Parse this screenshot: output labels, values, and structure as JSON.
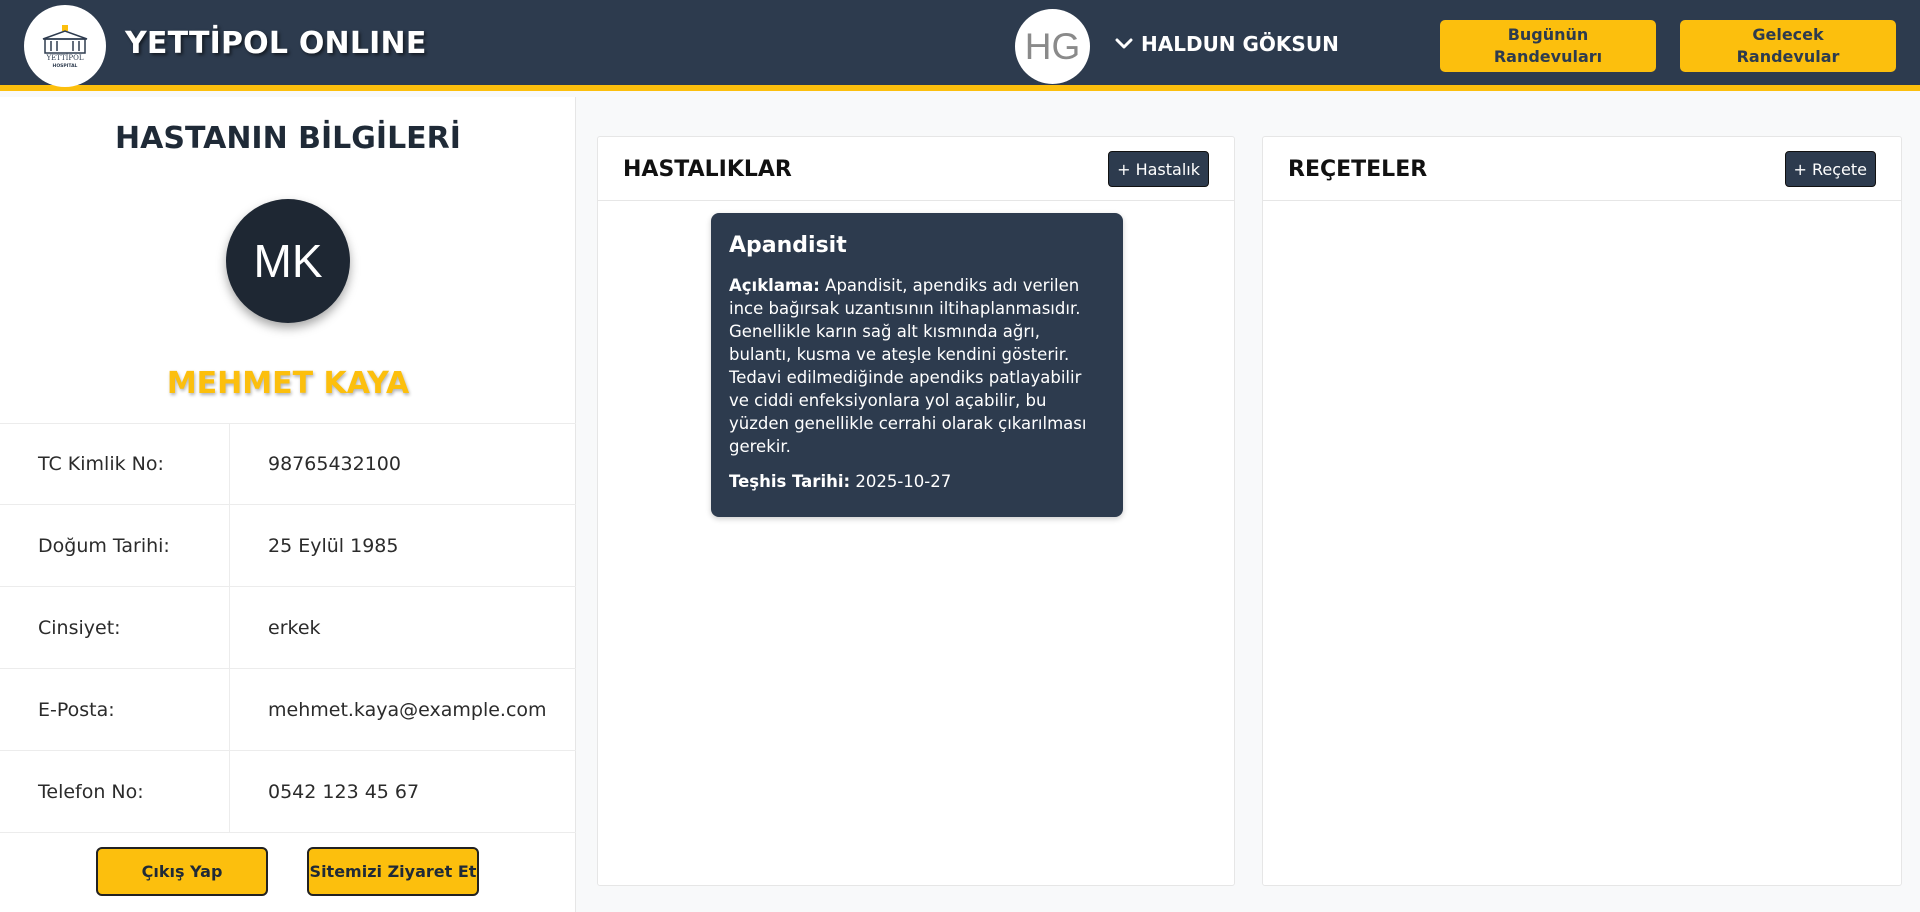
{
  "header": {
    "brand": "YETTİPOL ONLINE",
    "logo_text": "YETTİPOL",
    "logo_sub": "HOSPITAL",
    "doctor_initials": "HG",
    "doctor_name": "HALDUN GÖKSUN",
    "btn_today": "Bugünün Randevuları",
    "btn_future": "Gelecek Randevular"
  },
  "patient": {
    "section_title": "HASTANIN BİLGİLERİ",
    "initials": "MK",
    "name": "MEHMET KAYA",
    "rows": [
      {
        "label": "TC Kimlik No:",
        "value": "98765432100"
      },
      {
        "label": "Doğum Tarihi:",
        "value": "25 Eylül 1985"
      },
      {
        "label": "Cinsiyet:",
        "value": "erkek"
      },
      {
        "label": "E-Posta:",
        "value": "mehmet.kaya@example.com"
      },
      {
        "label": "Telefon No:",
        "value": "0542 123 45 67"
      }
    ],
    "btn_logout": "Çıkış Yap",
    "btn_visit": "Sitemizi Ziyaret Et"
  },
  "diseases": {
    "title": "HASTALIKLAR",
    "add_label": "+ Hastalık",
    "items": [
      {
        "name": "Apandisit",
        "desc_label": "Açıklama:",
        "desc": "Apandisit, apendiks adı verilen ince bağırsak uzantısının iltihaplanmasıdır. Genellikle karın sağ alt kısmında ağrı, bulantı, kusma ve ateşle kendini gösterir. Tedavi edilmediğinde apendiks patlayabilir ve ciddi enfeksiyonlara yol açabilir, bu yüzden genellikle cerrahi olarak çıkarılması gerekir.",
        "date_label": "Teşhis Tarihi:",
        "date": "2025-10-27"
      }
    ]
  },
  "prescriptions": {
    "title": "REÇETELER",
    "add_label": "+ Reçete"
  },
  "colors": {
    "navy": "#2d3b4e",
    "accent": "#fcbf0d"
  }
}
